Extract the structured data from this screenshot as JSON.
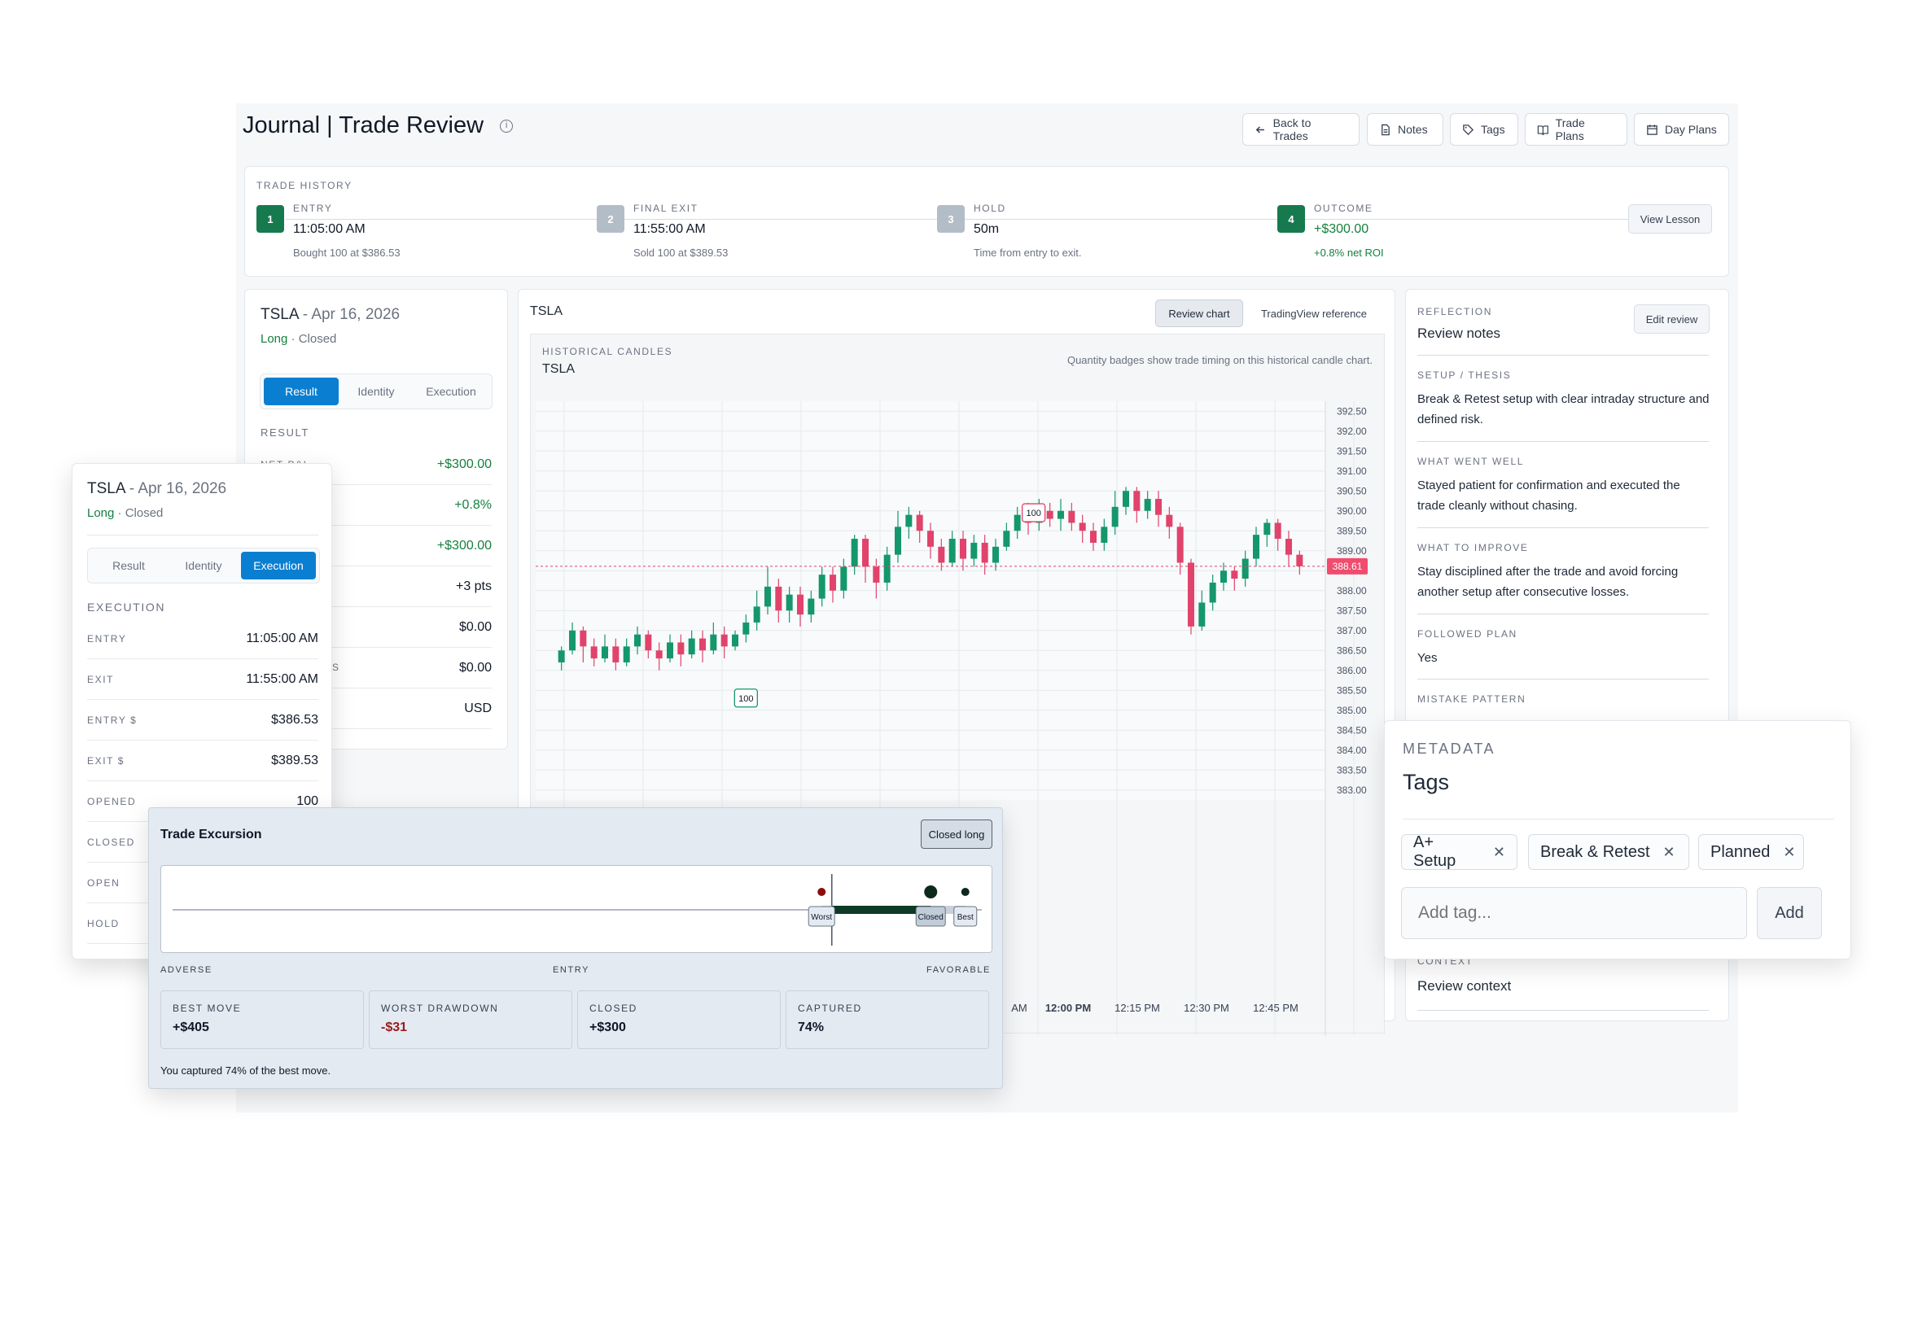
{
  "header": {
    "title": "Journal | Trade Review",
    "buttons": {
      "back": "Back to Trades",
      "notes": "Notes",
      "tags": "Tags",
      "trade_plans": "Trade Plans",
      "day_plans": "Day Plans"
    }
  },
  "history": {
    "label": "TRADE HISTORY",
    "steps": [
      {
        "num": "1",
        "label": "ENTRY",
        "value": "11:05:00 AM",
        "sub": "Bought 100 at $386.53",
        "color": "#167a4e"
      },
      {
        "num": "2",
        "label": "FINAL EXIT",
        "value": "11:55:00 AM",
        "sub": "Sold 100 at $389.53",
        "color": "#b3bdc8"
      },
      {
        "num": "3",
        "label": "HOLD",
        "value": "50m",
        "sub": "Time from entry to exit.",
        "color": "#b3bdc8"
      },
      {
        "num": "4",
        "label": "OUTCOME",
        "value": "+$300.00",
        "sub": "+0.8% net ROI",
        "color": "#167a4e"
      }
    ],
    "view_lesson": "View Lesson"
  },
  "summary": {
    "symbol": "TSLA",
    "date": " - Apr 16, 2026",
    "side": "Long",
    "status": " · Closed",
    "tabs": [
      "Result",
      "Identity",
      "Execution"
    ],
    "section": "RESULT",
    "row_label_partial": "NET P&L",
    "row_label_partial2": "S",
    "rows": [
      "+$300.00",
      "+0.8%",
      "+$300.00",
      "+3 pts",
      "$0.00",
      "$0.00",
      "USD"
    ]
  },
  "overlay_card": {
    "symbol": "TSLA",
    "date": " - Apr 16, 2026",
    "side": "Long",
    "status": " · Closed",
    "tabs": [
      "Result",
      "Identity",
      "Execution"
    ],
    "section": "EXECUTION",
    "rows": [
      {
        "label": "ENTRY",
        "value": "11:05:00 AM"
      },
      {
        "label": "EXIT",
        "value": "11:55:00 AM"
      },
      {
        "label": "ENTRY $",
        "value": "$386.53"
      },
      {
        "label": "EXIT $",
        "value": "$389.53"
      },
      {
        "label": "OPENED",
        "value": "100"
      },
      {
        "label": "CLOSED",
        "value": ""
      },
      {
        "label": "OPEN",
        "value": ""
      },
      {
        "label": "HOLD",
        "value": ""
      }
    ]
  },
  "chart_panel": {
    "symbol": "TSLA",
    "tab_review": "Review chart",
    "tab_tv": "TradingView reference",
    "inner_label": "HISTORICAL CANDLES",
    "inner_symbol": "TSLA",
    "note": "Quantity badges show trade timing on this historical candle chart.",
    "current_price_label": "388.61",
    "badge_entry": "100",
    "badge_exit": "100",
    "time_labels": [
      "AM",
      "12:00 PM",
      "12:15 PM",
      "12:30 PM",
      "12:45 PM"
    ]
  },
  "chart_data": {
    "type": "candlestick",
    "ylim": [
      382.75,
      392.75
    ],
    "y_ticks": [
      "392.50",
      "392.00",
      "391.50",
      "391.00",
      "390.50",
      "390.00",
      "389.50",
      "389.00",
      "388.50",
      "388.00",
      "387.50",
      "387.00",
      "386.50",
      "386.00",
      "385.50",
      "385.00",
      "384.50",
      "384.00",
      "383.50",
      "383.00"
    ],
    "current_price": 388.61,
    "markers": [
      {
        "label": "100",
        "price": 386.53
      },
      {
        "label": "100",
        "price": 389.83
      }
    ],
    "candles": [
      [
        386.2,
        386.5,
        386.0,
        386.6
      ],
      [
        386.5,
        387.0,
        386.4,
        387.2
      ],
      [
        387.0,
        386.6,
        386.2,
        387.1
      ],
      [
        386.6,
        386.3,
        386.1,
        386.8
      ],
      [
        386.3,
        386.6,
        386.2,
        386.9
      ],
      [
        386.6,
        386.2,
        386.0,
        386.8
      ],
      [
        386.2,
        386.6,
        386.1,
        386.8
      ],
      [
        386.6,
        386.9,
        386.4,
        387.1
      ],
      [
        386.9,
        386.5,
        386.3,
        387.0
      ],
      [
        386.5,
        386.3,
        386.0,
        386.7
      ],
      [
        386.3,
        386.7,
        386.2,
        386.9
      ],
      [
        386.7,
        386.4,
        386.1,
        386.9
      ],
      [
        386.4,
        386.8,
        386.3,
        387.0
      ],
      [
        386.8,
        386.5,
        386.2,
        387.0
      ],
      [
        386.5,
        386.9,
        386.4,
        387.2
      ],
      [
        386.9,
        386.6,
        386.3,
        387.1
      ],
      [
        386.6,
        386.9,
        386.5,
        387.0
      ],
      [
        386.9,
        387.2,
        386.7,
        387.4
      ],
      [
        387.2,
        387.6,
        387.0,
        388.0
      ],
      [
        387.6,
        388.1,
        387.4,
        388.6
      ],
      [
        388.1,
        387.5,
        387.2,
        388.3
      ],
      [
        387.5,
        387.9,
        387.2,
        388.1
      ],
      [
        387.9,
        387.4,
        387.1,
        388.1
      ],
      [
        387.4,
        387.8,
        387.2,
        388.0
      ],
      [
        387.8,
        388.4,
        387.6,
        388.6
      ],
      [
        388.4,
        388.0,
        387.7,
        388.6
      ],
      [
        388.0,
        388.6,
        387.8,
        388.8
      ],
      [
        388.6,
        389.3,
        388.4,
        389.4
      ],
      [
        389.3,
        388.6,
        388.2,
        389.4
      ],
      [
        388.6,
        388.2,
        387.8,
        388.8
      ],
      [
        388.2,
        388.9,
        388.0,
        389.1
      ],
      [
        388.9,
        389.6,
        388.7,
        390.0
      ],
      [
        389.6,
        389.9,
        389.3,
        390.1
      ],
      [
        389.9,
        389.5,
        389.2,
        390.0
      ],
      [
        389.5,
        389.1,
        388.8,
        389.7
      ],
      [
        389.1,
        388.7,
        388.5,
        389.3
      ],
      [
        388.7,
        389.3,
        388.6,
        389.5
      ],
      [
        389.3,
        388.8,
        388.5,
        389.5
      ],
      [
        388.8,
        389.2,
        388.6,
        389.4
      ],
      [
        389.2,
        388.7,
        388.4,
        389.4
      ],
      [
        388.7,
        389.1,
        388.5,
        389.3
      ],
      [
        389.1,
        389.5,
        389.0,
        389.7
      ],
      [
        389.5,
        389.9,
        389.3,
        390.1
      ],
      [
        389.9,
        389.7,
        389.4,
        390.2
      ],
      [
        389.7,
        390.0,
        389.5,
        390.3
      ],
      [
        390.0,
        389.8,
        389.6,
        390.2
      ],
      [
        389.8,
        390.0,
        389.5,
        390.3
      ],
      [
        390.0,
        389.7,
        389.5,
        390.2
      ],
      [
        389.7,
        389.5,
        389.2,
        389.9
      ],
      [
        389.5,
        389.2,
        389.0,
        389.7
      ],
      [
        389.2,
        389.6,
        389.0,
        389.8
      ],
      [
        389.6,
        390.1,
        389.4,
        390.5
      ],
      [
        390.1,
        390.5,
        389.9,
        390.6
      ],
      [
        390.5,
        390.0,
        389.7,
        390.6
      ],
      [
        390.0,
        390.3,
        389.8,
        390.5
      ],
      [
        390.3,
        389.9,
        389.6,
        390.5
      ],
      [
        389.9,
        389.6,
        389.3,
        390.1
      ],
      [
        389.6,
        388.7,
        388.4,
        389.7
      ],
      [
        388.7,
        387.1,
        386.9,
        388.8
      ],
      [
        387.1,
        387.7,
        387.0,
        388.0
      ],
      [
        387.7,
        388.2,
        387.5,
        388.4
      ],
      [
        388.2,
        388.5,
        388.0,
        388.7
      ],
      [
        388.5,
        388.3,
        388.0,
        388.6
      ],
      [
        388.3,
        388.8,
        388.1,
        389.0
      ],
      [
        388.8,
        389.4,
        388.6,
        389.6
      ],
      [
        389.4,
        389.7,
        389.1,
        389.8
      ],
      [
        389.7,
        389.3,
        389.0,
        389.8
      ],
      [
        389.3,
        388.9,
        388.6,
        389.5
      ],
      [
        388.9,
        388.61,
        388.4,
        389.0
      ]
    ]
  },
  "reflection": {
    "label": "REFLECTION",
    "title": "Review notes",
    "edit": "Edit review",
    "items": [
      {
        "label": "SETUP / THESIS",
        "text": "Break & Retest setup with clear intraday structure and defined risk."
      },
      {
        "label": "WHAT WENT WELL",
        "text": "Stayed patient for confirmation and executed the trade cleanly without chasing."
      },
      {
        "label": "WHAT TO IMPROVE",
        "text": "Stay disciplined after the trade and avoid forcing another setup after consecutive losses."
      },
      {
        "label": "FOLLOWED PLAN",
        "text": "Yes"
      },
      {
        "label": "MISTAKE PATTERN",
        "text": ""
      }
    ],
    "context_label": "CONTEXT",
    "context_title": "Review context"
  },
  "metadata": {
    "label": "METADATA",
    "title": "Tags",
    "tags": [
      "A+ Setup",
      "Break & Retest",
      "Planned"
    ],
    "placeholder": "Add tag...",
    "add": "Add"
  },
  "excursion": {
    "title": "Trade Excursion",
    "badge": "Closed long",
    "axis": {
      "left": "ADVERSE",
      "center": "ENTRY",
      "right": "FAVORABLE"
    },
    "markers": {
      "worst": "Worst",
      "closed": "Closed",
      "best": "Best"
    },
    "values": {
      "worst": -31,
      "closed": 300,
      "best": 405
    },
    "stats": [
      {
        "label": "BEST MOVE",
        "value": "+$405",
        "color": "#111827"
      },
      {
        "label": "WORST DRAWDOWN",
        "value": "-$31",
        "color": "#991b1b"
      },
      {
        "label": "CLOSED",
        "value": "+$300",
        "color": "#111827"
      },
      {
        "label": "CAPTURED",
        "value": "74%",
        "color": "#111827"
      }
    ],
    "footer": "You captured 74% of the best move."
  },
  "colors": {
    "up": "#14976b",
    "down": "#e0436b",
    "accent": "#0a7fd1",
    "green": "#167a4e"
  }
}
